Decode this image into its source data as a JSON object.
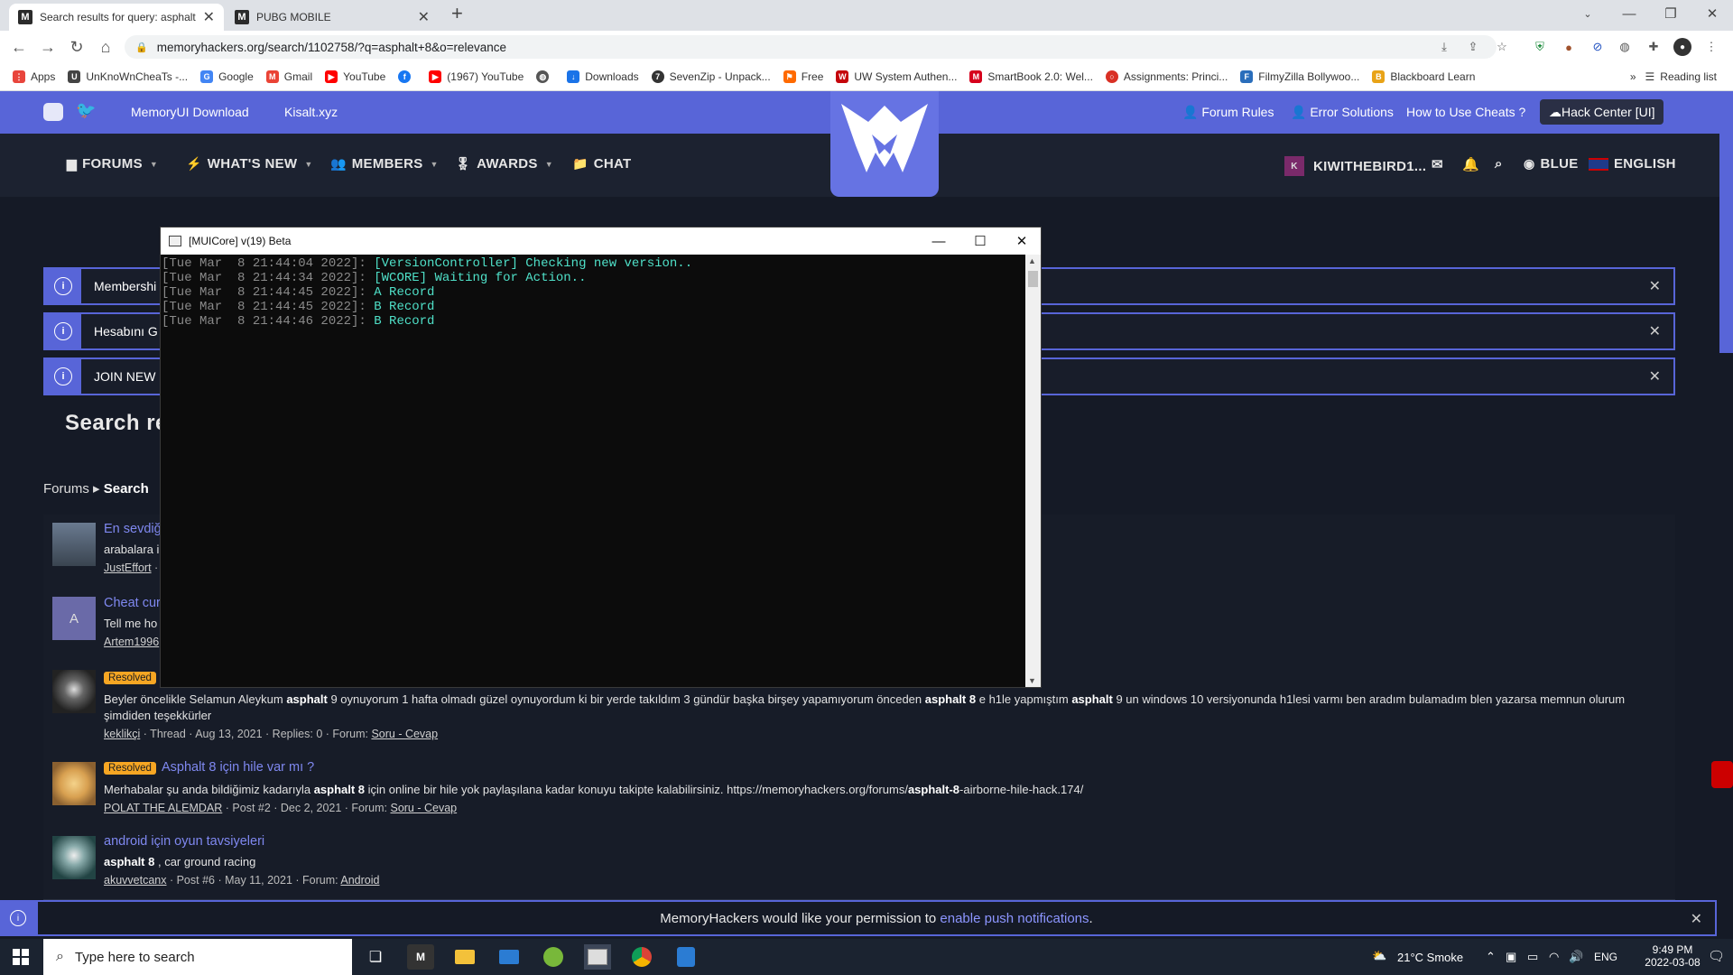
{
  "browser": {
    "tabs": [
      {
        "title": "Search results for query: asphalt",
        "favicon": "M",
        "active": true
      },
      {
        "title": "PUBG MOBILE",
        "favicon": "M",
        "active": false
      }
    ],
    "url": "memoryhackers.org/search/1102758/?q=asphalt+8&o=relevance",
    "bookmarks": [
      {
        "label": "Apps",
        "color": "#e8453c"
      },
      {
        "label": "UnKnoWnCheaTs -...",
        "color": "#444"
      },
      {
        "label": "Google",
        "color": "#4285f4"
      },
      {
        "label": "Gmail",
        "color": "#ea4335"
      },
      {
        "label": "YouTube",
        "color": "#ff0000"
      },
      {
        "label": "",
        "color": "#1877f2"
      },
      {
        "label": "(1967) YouTube",
        "color": "#ff0000"
      },
      {
        "label": "",
        "color": "#555"
      },
      {
        "label": "Downloads",
        "color": "#1a73e8"
      },
      {
        "label": "SevenZip - Unpack...",
        "color": "#333"
      },
      {
        "label": "Free",
        "color": "#ff6a00"
      },
      {
        "label": "UW System Authen...",
        "color": "#c5050c"
      },
      {
        "label": "SmartBook 2.0: Wel...",
        "color": "#d6001c"
      },
      {
        "label": "Assignments: Princi...",
        "color": "#d93025"
      },
      {
        "label": "FilmyZilla Bollywoo...",
        "color": "#2a6ebb"
      },
      {
        "label": "Blackboard Learn",
        "color": "#e8a317"
      }
    ],
    "reading_list": "Reading list"
  },
  "site": {
    "top_links_left": [
      "MemoryUI Download",
      "Kisalt.xyz"
    ],
    "top_links_right": [
      "Forum Rules",
      "Error Solutions",
      "How to Use Cheats ?"
    ],
    "hack_center": "Hack Center [UI]",
    "nav": [
      {
        "label": "FORUMS",
        "icon": "comments-icon"
      },
      {
        "label": "WHAT'S NEW",
        "icon": "bolt-icon"
      },
      {
        "label": "MEMBERS",
        "icon": "users-icon"
      },
      {
        "label": "AWARDS",
        "icon": "award-icon"
      },
      {
        "label": "CHAT",
        "icon": "folder-icon"
      }
    ],
    "user": "KIWITHEBIRD1...",
    "user_initial": "K",
    "style": "BLUE",
    "language": "ENGLISH",
    "notices": [
      "Membershi",
      "Hesabını G",
      "JOIN NEW D"
    ],
    "page_title": "Search re",
    "breadcrumb": {
      "root": "Forums",
      "current": "Search"
    },
    "results": [
      {
        "title": "En sevdiğ",
        "snippet": "arabalara i",
        "meta_user": "JustEffort",
        "meta_rest": " ·"
      },
      {
        "title": "Cheat cur",
        "snippet": "Tell me ho",
        "meta_user": "Artem1996",
        "avatar_letter": "A"
      },
      {
        "badge": "Resolved",
        "snippet_parts": [
          "Beyler öncelikle Selamun Aleykum ",
          "asphalt",
          " 9 oynuyorum 1 hafta olmadı güzel oynuyordum ki bir yerde takıldım 3 gündür başka birşey yapamıyorum önceden ",
          "asphalt 8",
          " e h1le yapmıştım ",
          "asphalt",
          " 9 un windows 10 versiyonunda h1lesi varmı ben aradım bulamadım blen yazarsa memnun olurum şimdiden teşekkürler"
        ],
        "meta_user": "keklikçi",
        "meta_rest": " · Thread · Aug 13, 2021 · Replies: 0 · Forum: ",
        "meta_forum": "Soru - Cevap"
      },
      {
        "badge": "Resolved",
        "title": "Asphalt 8 için hile var mı ?",
        "snippet_parts": [
          "Merhabalar şu anda bildiğimiz kadarıyla ",
          "asphalt 8",
          " için online bir hile yok paylaşılana kadar konuyu takipte kalabilirsiniz. https://memoryhackers.org/forums/",
          "asphalt-8",
          "-airborne-hile-hack.174/"
        ],
        "meta_user": "POLAT THE ALEMDAR",
        "meta_rest": " · Post #2 · Dec 2, 2021 · Forum: ",
        "meta_forum": "Soru - Cevap"
      },
      {
        "title": "android için oyun tavsiyeleri",
        "snippet_parts": [
          "asphalt 8",
          " , car ground racing"
        ],
        "meta_user": "akuvvetcanx",
        "meta_rest": " · Post #6 · May 11, 2021 · Forum: ",
        "meta_forum": "Android"
      }
    ],
    "push": {
      "text": "MemoryHackers would like your permission to ",
      "link": "enable push notifications",
      "end": "."
    }
  },
  "console": {
    "title": "[MUICore] v(19) Beta",
    "lines": [
      {
        "ts": "[Tue Mar  8 21:44:04 2022]: ",
        "msg": "[VersionController] Checking new version.."
      },
      {
        "ts": "[Tue Mar  8 21:44:34 2022]: ",
        "msg": "[WCORE] Waiting for Action.."
      },
      {
        "ts": "[Tue Mar  8 21:44:45 2022]: ",
        "msg": "A Record"
      },
      {
        "ts": "[Tue Mar  8 21:44:45 2022]: ",
        "msg": "B Record"
      },
      {
        "ts": "[Tue Mar  8 21:44:46 2022]: ",
        "msg": "B Record"
      }
    ]
  },
  "taskbar": {
    "search_placeholder": "Type here to search",
    "weather": "21°C  Smoke",
    "lang": "ENG",
    "time": "9:49 PM",
    "date": "2022-03-08"
  },
  "colors": {
    "accent": "#5865d8",
    "link": "#7f88f0",
    "console_text": "#4fe0c8",
    "badge": "#f6a623"
  }
}
